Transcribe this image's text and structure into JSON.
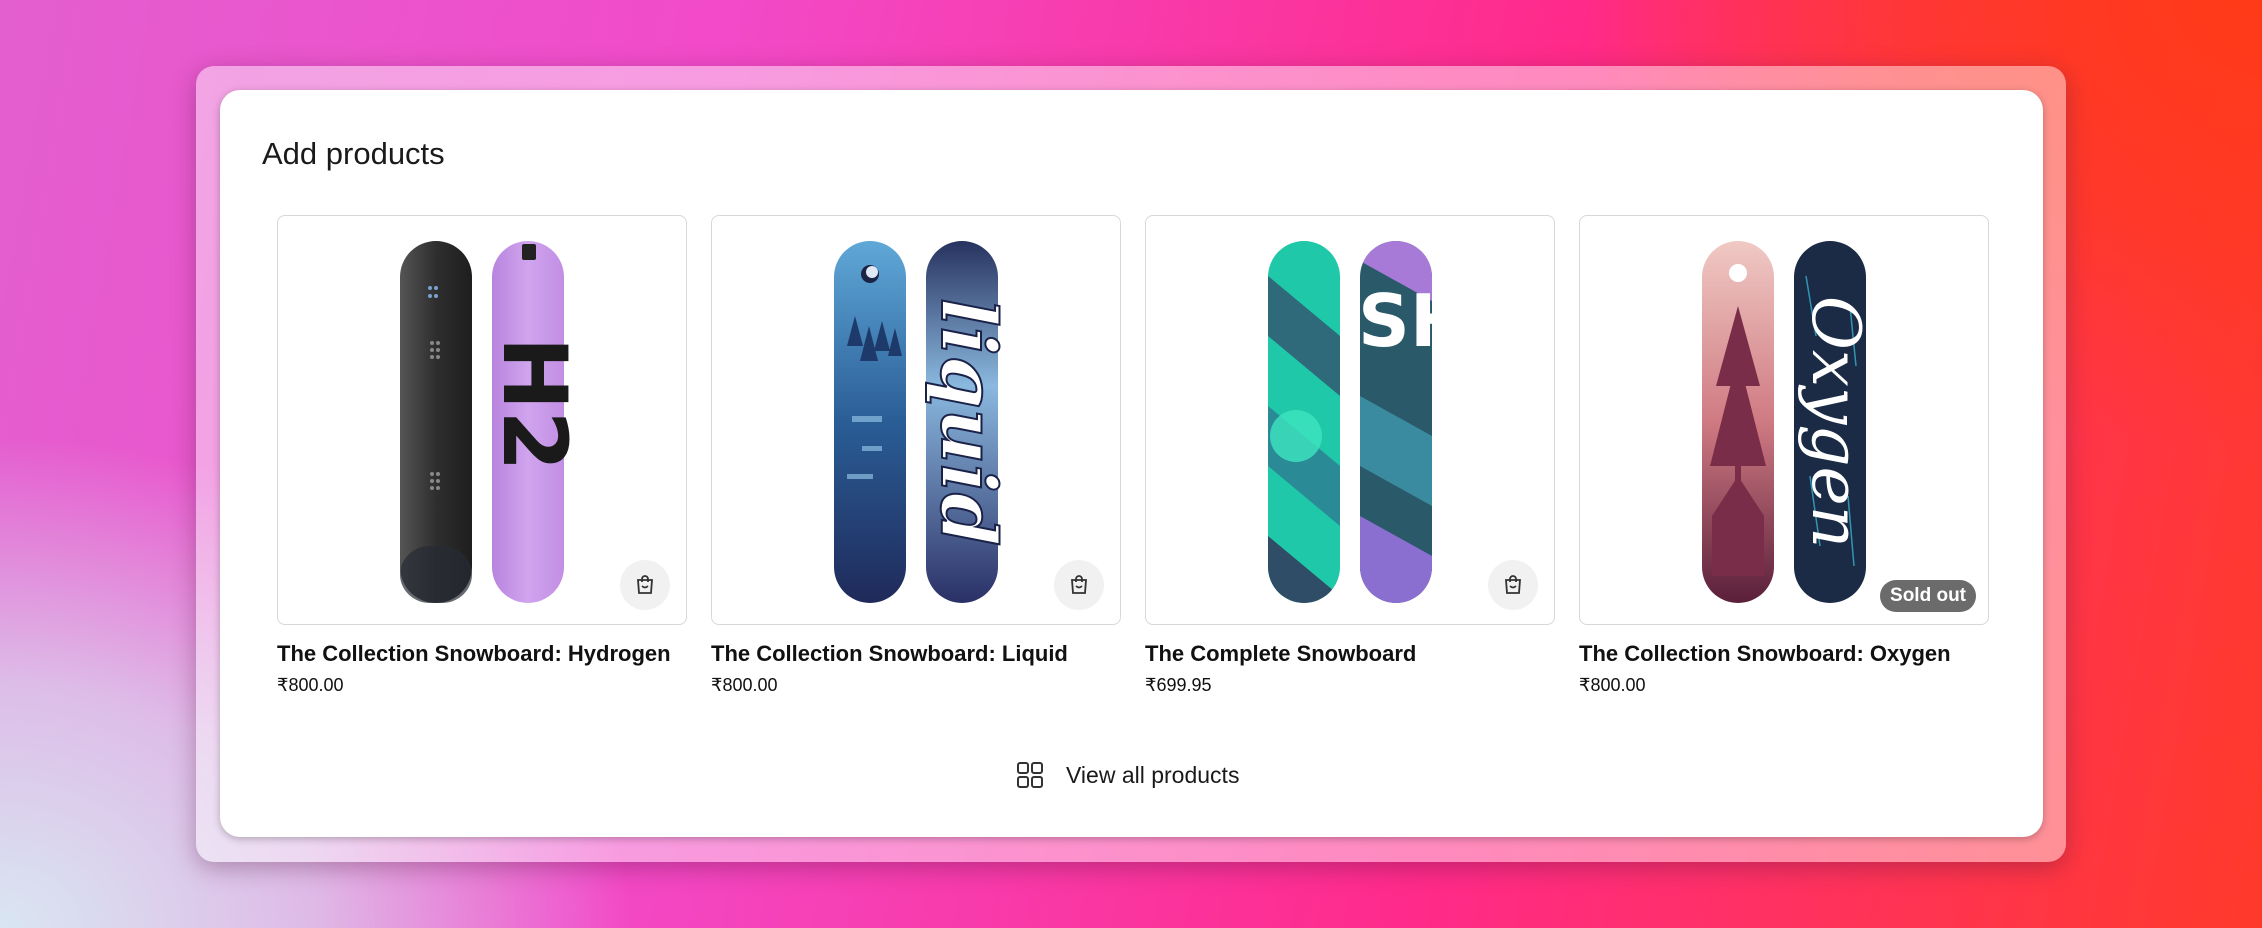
{
  "section": {
    "title": "Add products",
    "view_all_label": "View all products"
  },
  "products": [
    {
      "name": "The Collection Snowboard: Hydrogen",
      "price": "₹800.00",
      "board_text": "H2",
      "board_colors": [
        "#3a3a3a",
        "#c79be6"
      ]
    },
    {
      "name": "The Collection Snowboard: Liquid",
      "price": "₹800.00",
      "board_text": "liquid",
      "board_colors": [
        "#2b5a8e",
        "#1e2d5c"
      ]
    },
    {
      "name": "The Complete Snowboard",
      "price": "₹699.95",
      "board_text": "SHOPIFY",
      "board_colors": [
        "#1fc8a8",
        "#2a5a6a"
      ]
    },
    {
      "name": "The Collection Snowboard: Oxygen",
      "price": "₹800.00",
      "board_text": "Oxygen",
      "board_colors": [
        "#c46a7a",
        "#1b2a45"
      ],
      "badge": "Sold out"
    }
  ],
  "icons": {
    "quick_add": "shopping-bag-icon",
    "view_all": "grid-icon"
  }
}
